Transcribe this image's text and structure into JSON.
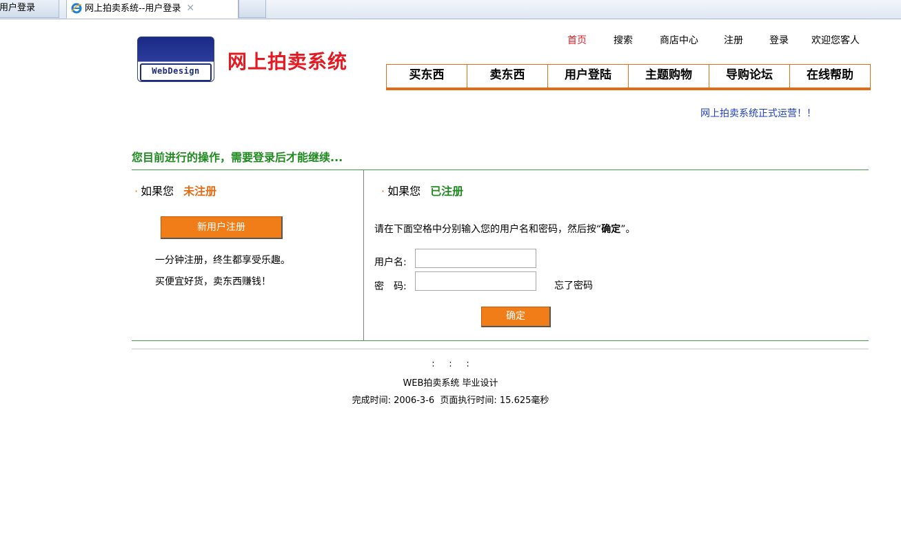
{
  "browser": {
    "tabs": [
      {
        "label": "用户登录"
      },
      {
        "label": "网上拍卖系统--用户登录",
        "close": "✕"
      },
      {
        "label": ""
      }
    ]
  },
  "site": {
    "logo_text": "WebDesign",
    "title": "网上拍卖系统"
  },
  "toplinks": [
    "首页",
    "搜索",
    "商店中心",
    "注册",
    "登录",
    "欢迎您客人"
  ],
  "nav": [
    "买东西",
    "卖东西",
    "用户登陆",
    "主题购物",
    "导购论坛",
    "在线帮助"
  ],
  "marquee": "网上拍卖系统正式运营！！",
  "heading": "您目前进行的操作，需要登录后才能继续...",
  "left": {
    "bullet": "·",
    "prefix": "如果您",
    "status": "未注册",
    "register_button": "新用户注册",
    "line1": "一分钟注册，终生都享受乐趣。",
    "line2": "买便宜好货，卖东西赚钱！"
  },
  "right": {
    "bullet": "·",
    "prefix": "如果您",
    "status": "已注册",
    "instruction_prefix": "请在下面空格中分别输入您的用户名和密码，然后按“",
    "instruction_bold": "确定",
    "instruction_suffix": "”。",
    "username_label": "用户名:",
    "password_label": "密　码:",
    "username_value": "",
    "password_value": "",
    "forgot_link": "忘了密码",
    "submit_button": "确定"
  },
  "footer": {
    "line1": ":     :     :",
    "line2": "WEB拍卖系统 毕业设计",
    "line3": "完成时间: 2006-3-6  页面执行时间: 15.625毫秒"
  },
  "colors": {
    "accent_orange": "#f07d18",
    "title_red": "#e31a22",
    "heading_green": "#1f8a1f",
    "link_blue": "#1f3fbf"
  }
}
